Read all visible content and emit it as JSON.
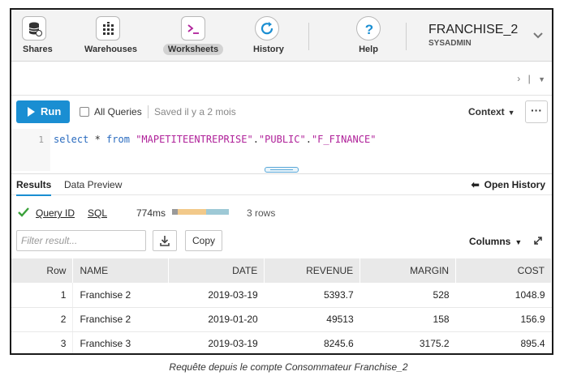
{
  "nav": {
    "items": [
      {
        "label": "Shares",
        "icon": "database-share-icon"
      },
      {
        "label": "Warehouses",
        "icon": "warehouse-grid-icon"
      },
      {
        "label": "Worksheets",
        "icon": "terminal-icon"
      },
      {
        "label": "History",
        "icon": "history-refresh-icon"
      },
      {
        "label": "Help",
        "icon": "question-icon"
      }
    ],
    "active": "Worksheets"
  },
  "account": {
    "name": "FRANCHISE_2",
    "role": "SYSADMIN"
  },
  "runbar": {
    "run_label": "Run",
    "all_queries_label": "All Queries",
    "all_queries_checked": false,
    "saved_label": "Saved il y a 2 mois",
    "context_label": "Context",
    "more_label": "···"
  },
  "editor": {
    "line_number": "1",
    "tokens": {
      "select": "select",
      "star": " * ",
      "from": "from",
      "space": " ",
      "db": "\"MAPETITEENTREPRISE\"",
      "dot1": ".",
      "schema": "\"PUBLIC\"",
      "dot2": ".",
      "table": "\"F_FINANCE\""
    }
  },
  "results": {
    "tabs": [
      "Results",
      "Data Preview"
    ],
    "open_history_label": "Open History",
    "query_id_label": "Query ID",
    "sql_label": "SQL",
    "duration": "774ms",
    "row_count": "3 rows",
    "filter_placeholder": "Filter result...",
    "copy_label": "Copy",
    "columns_label": "Columns",
    "timing_colors": [
      "#9a9a9a",
      "#f2c98a",
      "#9ec9d6"
    ],
    "columns": [
      "Row",
      "NAME",
      "DATE",
      "REVENUE",
      "MARGIN",
      "COST"
    ],
    "rows": [
      [
        "1",
        "Franchise 2",
        "2019-03-19",
        "5393.7",
        "528",
        "1048.9"
      ],
      [
        "2",
        "Franchise 2",
        "2019-01-20",
        "49513",
        "158",
        "156.9"
      ],
      [
        "3",
        "Franchise 3",
        "2019-03-19",
        "8245.6",
        "3175.2",
        "895.4"
      ]
    ]
  },
  "caption": "Requête depuis le compte Consommateur Franchise_2",
  "colors": {
    "accent": "#1a8ed2",
    "success": "#3aa13a"
  }
}
